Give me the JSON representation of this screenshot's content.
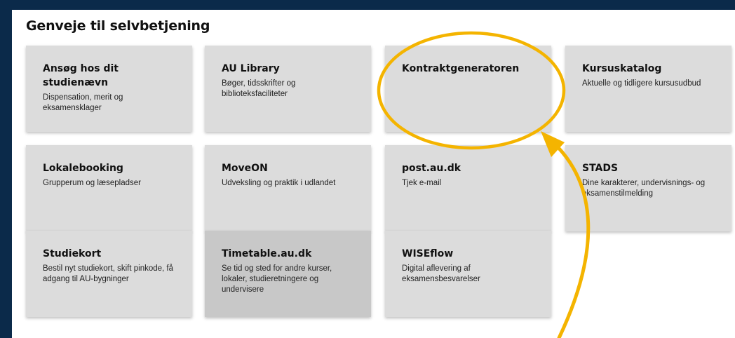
{
  "section": {
    "title": "Genveje til selvbetjening"
  },
  "tiles": [
    {
      "title": "Ansøg hos dit studienævn",
      "desc": "Dispensation, merit og eksamensklager"
    },
    {
      "title": "AU Library",
      "desc": "Bøger, tidsskrifter og biblioteksfaciliteter"
    },
    {
      "title": "Kontraktgeneratoren",
      "desc": ""
    },
    {
      "title": "Kursuskatalog",
      "desc": "Aktuelle og tidligere kursusudbud"
    },
    {
      "title": "Lokalebooking",
      "desc": "Grupperum og læsepladser"
    },
    {
      "title": "MoveON",
      "desc": "Udveksling og praktik i udlandet"
    },
    {
      "title": "post.au.dk",
      "desc": "Tjek e-mail"
    },
    {
      "title": "STADS",
      "desc": "Dine karakterer, undervisnings- og eksamenstilmelding"
    },
    {
      "title": "Studiekort",
      "desc": "Bestil nyt studiekort, skift pinkode, få adgang til AU-bygninger"
    },
    {
      "title": "Timetable.au.dk",
      "desc": "Se tid og sted for andre kurser, lokaler, studieretningere og undervisere"
    },
    {
      "title": "WISEflow",
      "desc": "Digital aflevering af eksamensbesvarelser"
    }
  ],
  "annotation": {
    "color": "#f4b400"
  },
  "colors": {
    "background": "#0b2a4a",
    "tile": "#dcdcdc",
    "tile_active": "#c8c8c8"
  }
}
